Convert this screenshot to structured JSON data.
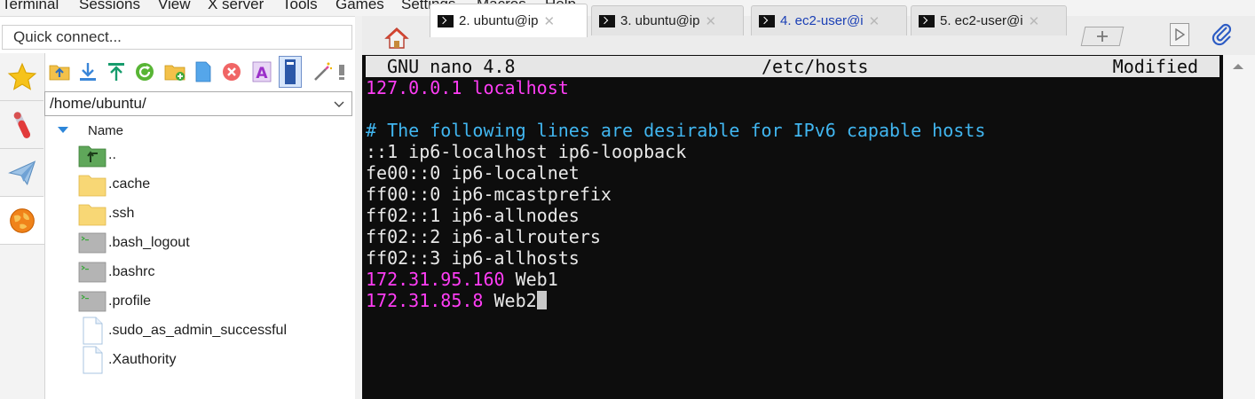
{
  "menu": {
    "items": [
      "Terminal",
      "Sessions",
      "View",
      "X server",
      "Tools",
      "Games",
      "Settings",
      "Macros",
      "Help"
    ]
  },
  "left_panel": {
    "quick_connect_placeholder": "Quick connect...",
    "side_tabs": [
      {
        "icon": "star-icon",
        "active": false
      },
      {
        "icon": "tools-icon",
        "active": false
      },
      {
        "icon": "paper-plane-icon",
        "active": false
      },
      {
        "icon": "globe-icon",
        "active": true
      }
    ],
    "toolbar": [
      {
        "icon": "folder-up-icon"
      },
      {
        "icon": "download-icon"
      },
      {
        "icon": "upload-icon"
      },
      {
        "icon": "refresh-icon"
      },
      {
        "icon": "new-folder-icon"
      },
      {
        "icon": "new-file-icon"
      },
      {
        "icon": "delete-icon"
      },
      {
        "icon": "rename-icon"
      },
      {
        "icon": "follow-terminal-icon"
      },
      {
        "icon": "magic-wand-icon"
      },
      {
        "icon": "more-icon"
      }
    ],
    "path": "/home/ubuntu/",
    "column_header": "Name",
    "files": [
      {
        "name": "..",
        "type": "parent"
      },
      {
        "name": ".cache",
        "type": "folder"
      },
      {
        "name": ".ssh",
        "type": "folder"
      },
      {
        "name": ".bash_logout",
        "type": "script"
      },
      {
        "name": ".bashrc",
        "type": "script"
      },
      {
        "name": ".profile",
        "type": "script"
      },
      {
        "name": ".sudo_as_admin_successful",
        "type": "file"
      },
      {
        "name": ".Xauthority",
        "type": "file"
      }
    ]
  },
  "tabs": [
    {
      "label": "2. ubuntu@ip",
      "active": true,
      "color": "#1e1e1e"
    },
    {
      "label": "3. ubuntu@ip",
      "active": false,
      "color": "#1e1e1e"
    },
    {
      "label": "4. ec2-user@i",
      "active": false,
      "color": "#1a3fb5"
    },
    {
      "label": "5. ec2-user@i",
      "active": false,
      "color": "#1e1e1e"
    }
  ],
  "terminal": {
    "header": {
      "left": "GNU nano 4.8",
      "center": "/etc/hosts",
      "right": "Modified"
    },
    "lines": [
      {
        "segments": [
          {
            "text": "127.0.0.1 localhost",
            "color": "magenta"
          }
        ]
      },
      {
        "segments": [
          {
            "text": "",
            "color": "white"
          }
        ]
      },
      {
        "segments": [
          {
            "text": "# The following lines are desirable for IPv6 capable hosts",
            "color": "cyan"
          }
        ]
      },
      {
        "segments": [
          {
            "text": "::1 ip6-localhost ip6-loopback",
            "color": "white"
          }
        ]
      },
      {
        "segments": [
          {
            "text": "fe00::0 ip6-localnet",
            "color": "white"
          }
        ]
      },
      {
        "segments": [
          {
            "text": "ff00::0 ip6-mcastprefix",
            "color": "white"
          }
        ]
      },
      {
        "segments": [
          {
            "text": "ff02::1 ip6-allnodes",
            "color": "white"
          }
        ]
      },
      {
        "segments": [
          {
            "text": "ff02::2 ip6-allrouters",
            "color": "white"
          }
        ]
      },
      {
        "segments": [
          {
            "text": "ff02::3 ip6-allhosts",
            "color": "white"
          }
        ]
      },
      {
        "segments": [
          {
            "text": "172.31.95.160",
            "color": "magenta"
          },
          {
            "text": " Web1",
            "color": "white"
          }
        ]
      },
      {
        "segments": [
          {
            "text": "172.31.85.8",
            "color": "magenta"
          },
          {
            "text": " Web2",
            "color": "white"
          }
        ],
        "cursor": true
      }
    ]
  },
  "colors": {
    "terminal_bg": "#0d0d0d",
    "magenta": "#ff3df5",
    "cyan": "#41b6f0",
    "folder_yellow": "#f8d775"
  }
}
